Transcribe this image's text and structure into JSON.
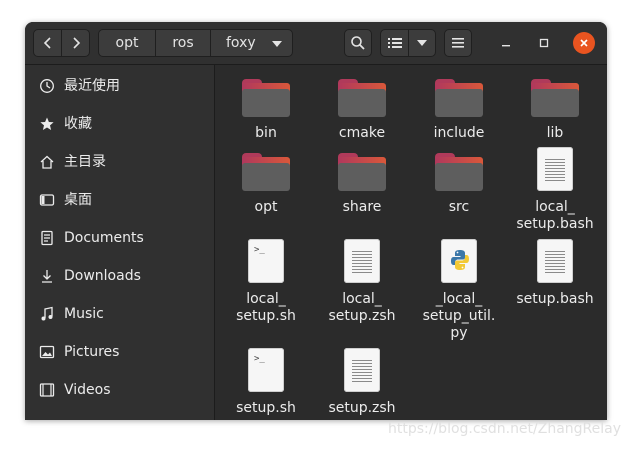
{
  "nav": {
    "back_icon": "chevron-left-icon",
    "forward_icon": "chevron-right-icon"
  },
  "path": [
    "opt",
    "ros",
    "foxy"
  ],
  "toolbar": {
    "search_icon": "search-icon",
    "view_icon": "list-view-icon",
    "menu_icon": "hamburger-icon"
  },
  "window_controls": {
    "minimize": "minimize-icon",
    "maximize": "maximize-icon",
    "close": "close-icon",
    "close_color": "#e95420"
  },
  "sidebar": {
    "items": [
      {
        "label": "最近使用",
        "icon": "clock-icon"
      },
      {
        "label": "收藏",
        "icon": "star-icon"
      },
      {
        "label": "主目录",
        "icon": "home-icon"
      },
      {
        "label": "桌面",
        "icon": "desktop-icon"
      },
      {
        "label": "Documents",
        "icon": "document-icon"
      },
      {
        "label": "Downloads",
        "icon": "download-icon"
      },
      {
        "label": "Music",
        "icon": "music-icon"
      },
      {
        "label": "Pictures",
        "icon": "picture-icon"
      },
      {
        "label": "Videos",
        "icon": "video-icon"
      }
    ]
  },
  "files": [
    {
      "name": "bin",
      "type": "folder"
    },
    {
      "name": "cmake",
      "type": "folder"
    },
    {
      "name": "include",
      "type": "folder"
    },
    {
      "name": "lib",
      "type": "folder"
    },
    {
      "name": "opt",
      "type": "folder"
    },
    {
      "name": "share",
      "type": "folder"
    },
    {
      "name": "src",
      "type": "folder"
    },
    {
      "name": "local_\nsetup.bash",
      "type": "text"
    },
    {
      "name": "local_\nsetup.sh",
      "type": "script"
    },
    {
      "name": "local_\nsetup.zsh",
      "type": "text"
    },
    {
      "name": "_local_\nsetup_util.\npy",
      "type": "python"
    },
    {
      "name": "setup.bash",
      "type": "text"
    },
    {
      "name": "setup.sh",
      "type": "script"
    },
    {
      "name": "setup.zsh",
      "type": "text"
    }
  ],
  "watermark": "https://blog.csdn.net/ZhangRelay"
}
